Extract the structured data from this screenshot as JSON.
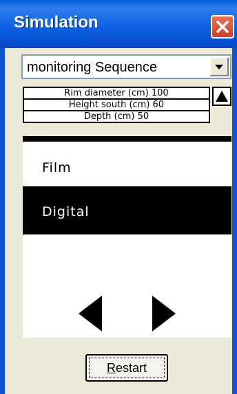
{
  "window": {
    "title": "Simulation"
  },
  "sequence_select": {
    "value": "monitoring Sequence"
  },
  "parameters": [
    {
      "label": "Rim diameter (cm) 100"
    },
    {
      "label": "Height south (cm) 60"
    },
    {
      "label": "Depth (cm) 50"
    }
  ],
  "options": {
    "film": "Film",
    "digital": "Digital",
    "selected": "Digital"
  },
  "buttons": {
    "restart": "Restart"
  },
  "icons": {
    "close": "close-icon",
    "dropdown": "chevron-down-icon",
    "scroll_up": "arrow-up-icon",
    "prev": "arrow-left-icon",
    "next": "arrow-right-icon"
  },
  "colors": {
    "titlebar": "#0a5fd8",
    "close": "#d3553c",
    "background": "#ece9d8"
  }
}
